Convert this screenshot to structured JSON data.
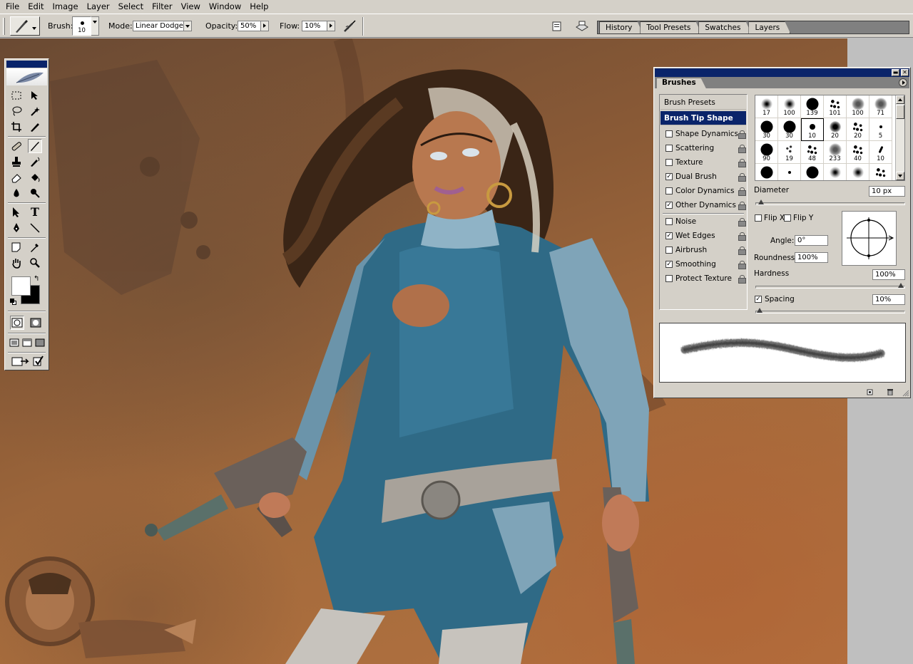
{
  "menubar": {
    "items": [
      "File",
      "Edit",
      "Image",
      "Layer",
      "Select",
      "Filter",
      "View",
      "Window",
      "Help"
    ]
  },
  "options": {
    "brush_label": "Brush:",
    "brush_size": "10",
    "mode_label": "Mode:",
    "mode_value": "Linear Dodge",
    "opacity_label": "Opacity:",
    "opacity_value": "50%",
    "flow_label": "Flow:",
    "flow_value": "10%"
  },
  "palette_well": {
    "tabs": [
      "History",
      "Tool Presets",
      "Swatches",
      "Layers"
    ]
  },
  "brushes_panel": {
    "title": "Brushes",
    "presets_label": "Brush Presets",
    "tip_shape_label": "Brush Tip Shape",
    "settings": [
      {
        "label": "Shape Dynamics",
        "checked": false
      },
      {
        "label": "Scattering",
        "checked": false
      },
      {
        "label": "Texture",
        "checked": false
      },
      {
        "label": "Dual Brush",
        "checked": true
      },
      {
        "label": "Color Dynamics",
        "checked": false
      },
      {
        "label": "Other Dynamics",
        "checked": true
      },
      {
        "label": "Noise",
        "checked": false
      },
      {
        "label": "Wet Edges",
        "checked": true
      },
      {
        "label": "Airbrush",
        "checked": false
      },
      {
        "label": "Smoothing",
        "checked": true
      },
      {
        "label": "Protect Texture",
        "checked": false
      }
    ],
    "tips": [
      {
        "size": "17",
        "kind": "soft"
      },
      {
        "size": "100",
        "kind": "soft"
      },
      {
        "size": "139",
        "kind": "hard"
      },
      {
        "size": "101",
        "kind": "spatter"
      },
      {
        "size": "100",
        "kind": "chalk"
      },
      {
        "size": "71",
        "kind": "chalk"
      },
      {
        "size": "30",
        "kind": "hard"
      },
      {
        "size": "30",
        "kind": "hard"
      },
      {
        "size": "10",
        "kind": "hard-small"
      },
      {
        "size": "20",
        "kind": "soft-dark"
      },
      {
        "size": "20",
        "kind": "spatter"
      },
      {
        "size": "5",
        "kind": "tiny"
      },
      {
        "size": "90",
        "kind": "hard"
      },
      {
        "size": "19",
        "kind": "leaf"
      },
      {
        "size": "48",
        "kind": "spatter"
      },
      {
        "size": "233",
        "kind": "chalk"
      },
      {
        "size": "40",
        "kind": "spatter"
      },
      {
        "size": "10",
        "kind": "slash"
      },
      {
        "size": "",
        "kind": "hard"
      },
      {
        "size": "",
        "kind": "tiny"
      },
      {
        "size": "",
        "kind": "hard"
      },
      {
        "size": "",
        "kind": "soft"
      },
      {
        "size": "",
        "kind": "soft"
      },
      {
        "size": "",
        "kind": "spatter"
      }
    ],
    "selected_tip_index": 8,
    "diameter_label": "Diameter",
    "diameter_value": "10 px",
    "flip_x_label": "Flip X",
    "flip_y_label": "Flip Y",
    "angle_label": "Angle:",
    "angle_value": "0°",
    "roundness_label": "Roundness:",
    "roundness_value": "100%",
    "hardness_label": "Hardness",
    "hardness_value": "100%",
    "spacing_label": "Spacing",
    "spacing_value": "10%",
    "spacing_checked": true,
    "diameter_fraction": 0.02,
    "hardness_fraction": 1.0,
    "spacing_fraction": 0.01
  },
  "colors": {
    "titlebar": "#0a246a",
    "chrome": "#d4d0c8",
    "foreground": "#ffffff",
    "background": "#000000"
  }
}
